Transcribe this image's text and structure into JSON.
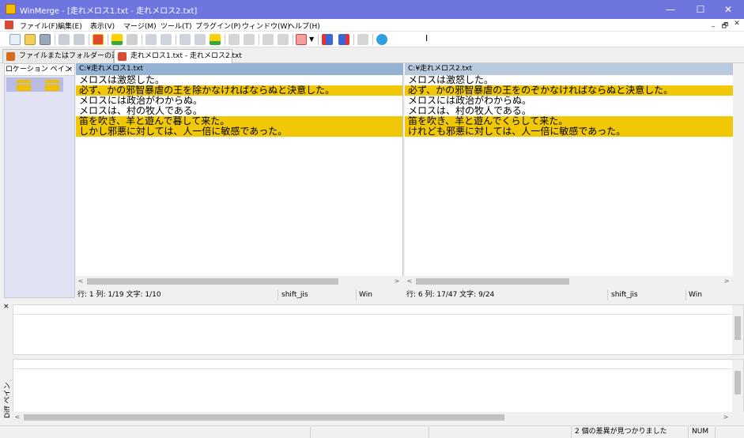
{
  "window": {
    "title": "WinMerge - [走れメロス1.txt - 走れメロス2.txt]"
  },
  "window_buttons": {
    "minimize": "—",
    "maximize": "☐",
    "close": "✕"
  },
  "menu": [
    "ファイル(F)",
    "編集(E)",
    "表示(V)",
    "マージ(M)",
    "ツール(T)",
    "プラグイン(P)",
    "ウィンドウ(W)",
    "ヘルプ(H)"
  ],
  "mdi_buttons": {
    "minimize": "_",
    "restore": "🗗",
    "close": "✕"
  },
  "tabs": [
    {
      "label": "ファイルまたはフォルダーの選択..."
    },
    {
      "label": "走れメロス1.txt - 走れメロス2.txt"
    }
  ],
  "location_pane": {
    "title": "ロケーション ペイン",
    "close": "×"
  },
  "left": {
    "path": "C:¥走れメロス1.txt",
    "lines": [
      "メロスは激怒した。",
      "必ず、かの邪智暴虐の王を除かなければならぬと決意した。",
      "メロスには政治がわからぬ。",
      "メロスは、村の牧人である。",
      "笛を吹き、羊と遊んで暮して来た。",
      "しかし邪悪に対しては、人一倍に敏感であった。"
    ],
    "status": {
      "position": "行: 1  列: 1/19  文字: 1/10",
      "encoding": "shift_jis",
      "eol": "Win"
    }
  },
  "right": {
    "path": "C:¥走れメロス2.txt",
    "lines": [
      "メロスは激怒した。",
      "必ず、かの邪智暴虐の王をのぞかなければならぬと決意した。",
      "メロスには政治がわからぬ。",
      "メロスは、村の牧人である。",
      "笛を吹き、羊と遊んでくらして来た。",
      "けれども邪悪に対しては、人一倍に敏感であった。"
    ],
    "status": {
      "position": "行: 6  列: 17/47  文字: 9/24",
      "encoding": "shift_jis",
      "eol": "Win"
    }
  },
  "diff_lines": [
    false,
    true,
    false,
    false,
    true,
    true
  ],
  "diff_pane": {
    "label": "Diff ペイン",
    "close": "×"
  },
  "scroll_arrows": {
    "left": "<",
    "right": ">"
  },
  "statusbar": {
    "message": "2 個の差異が見つかりました",
    "num": "NUM"
  },
  "colors": {
    "titlebar": "#6e75de",
    "diff_highlight": "#f1c808",
    "location_bg": "#e1e2f3"
  }
}
